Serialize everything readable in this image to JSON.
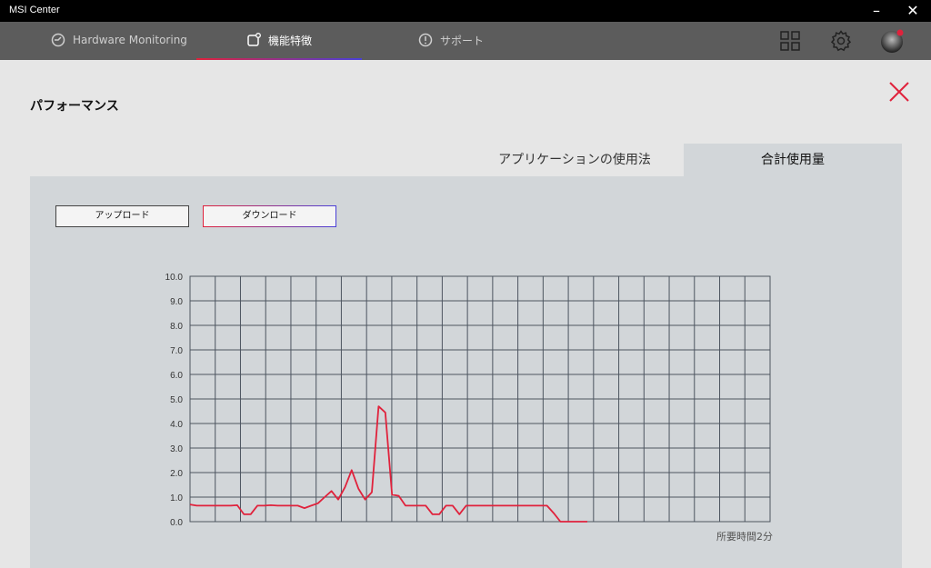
{
  "window": {
    "title": "MSI Center",
    "minimize": "–",
    "close": "✕"
  },
  "nav": {
    "tabs": [
      {
        "label": "Hardware Monitoring",
        "icon": "gauge-icon"
      },
      {
        "label": "機能特徴",
        "icon": "feature-icon"
      },
      {
        "label": "サポート",
        "icon": "info-icon"
      }
    ],
    "active_index": 1,
    "right_icons": [
      "grid-icon",
      "gear-icon",
      "avatar"
    ]
  },
  "panel": {
    "title": "パフォーマンス",
    "tabs": [
      "アプリケーションの使用法",
      "合計使用量"
    ],
    "active_tab": 1,
    "buttons": {
      "upload": "アップロード",
      "download": "ダウンロード"
    },
    "accent_red": "#e0223c",
    "accent_blue": "#4a40d8"
  },
  "chart_data": {
    "type": "line",
    "xlabel": "所要時間2分",
    "ylim": [
      0,
      10
    ],
    "yticks": [
      "0.0",
      "1.0",
      "2.0",
      "3.0",
      "4.0",
      "5.0",
      "6.0",
      "7.0",
      "8.0",
      "9.0",
      "10.0"
    ],
    "x_divisions": 23,
    "series": [
      {
        "color": "#e0223c",
        "values": [
          0.7,
          0.65,
          0.65,
          0.65,
          0.65,
          0.65,
          0.65,
          0.67,
          0.3,
          0.3,
          0.65,
          0.65,
          0.67,
          0.65,
          0.65,
          0.65,
          0.65,
          0.55,
          0.65,
          0.75,
          1.0,
          1.25,
          0.9,
          1.4,
          2.1,
          1.35,
          0.9,
          1.2,
          4.7,
          4.45,
          1.1,
          1.05,
          0.65,
          0.65,
          0.65,
          0.65,
          0.3,
          0.3,
          0.65,
          0.65,
          0.3,
          0.65,
          0.65,
          0.65,
          0.65,
          0.65,
          0.65,
          0.65,
          0.65,
          0.65,
          0.65,
          0.65,
          0.65,
          0.65,
          0.35,
          0.0,
          0.0,
          0.0,
          0.0,
          0.0
        ]
      }
    ]
  }
}
